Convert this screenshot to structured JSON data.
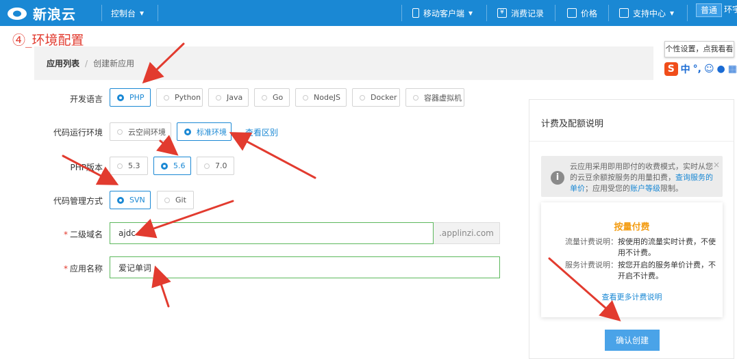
{
  "topbar": {
    "logo": "新浪云",
    "console": "控制台",
    "mobile": "移动客户端",
    "billing_records": "消费记录",
    "price": "价格",
    "support": "支持中心",
    "badge": "普通",
    "user": "环宇"
  },
  "step_title": "④_环境配置",
  "breadcrumb": {
    "app_list": "应用列表",
    "separator": "/",
    "create_app": "创建新应用"
  },
  "tooltip": "个性设置，点我看看",
  "ime": {
    "logo": "S",
    "mode": "中",
    "punct": "°,",
    "emoji": "☺"
  },
  "form": {
    "language_label": "开发语言",
    "languages": [
      "PHP",
      "Python",
      "Java",
      "Go",
      "NodeJS",
      "Docker",
      "容器虚拟机"
    ],
    "env_label": "代码运行环境",
    "envs": [
      "云空间环境",
      "标准环境"
    ],
    "env_link": "查看区别",
    "php_label": "PHP版本",
    "php_versions": [
      "5.3",
      "5.6",
      "7.0"
    ],
    "vcs_label": "代码管理方式",
    "vcs": [
      "SVN",
      "Git"
    ],
    "required_mark": "*",
    "domain_label": "二级域名",
    "domain_value": "ajdc",
    "domain_suffix": ".applinzi.com",
    "name_label": "应用名称",
    "name_value": "爱记单词"
  },
  "panel": {
    "title": "计费及配额说明",
    "notice_close": "×",
    "notice_part1": "云应用采用即用即付的收费模式，实时从您的云豆余额按服务的用量扣费，",
    "notice_link1": "查询服务的单价",
    "notice_part2": "；应用受您的",
    "notice_link2": "账户等级",
    "notice_part3": "限制。",
    "billing_title": "按量付费",
    "traffic_key": "流量计费说明：",
    "traffic_val": "按使用的流量实时计费，不使用不计费。",
    "service_key": "服务计费说明：",
    "service_val": "按您开启的服务单价计费，不开启不计费。",
    "more_link": "查看更多计费说明",
    "confirm": "确认创建"
  },
  "colors": {
    "topbar": "#1a88d4",
    "accent": "#1a88d4",
    "annotation": "#e23b2f",
    "billing_title": "#f39c12",
    "valid_border": "#5cb85c"
  }
}
